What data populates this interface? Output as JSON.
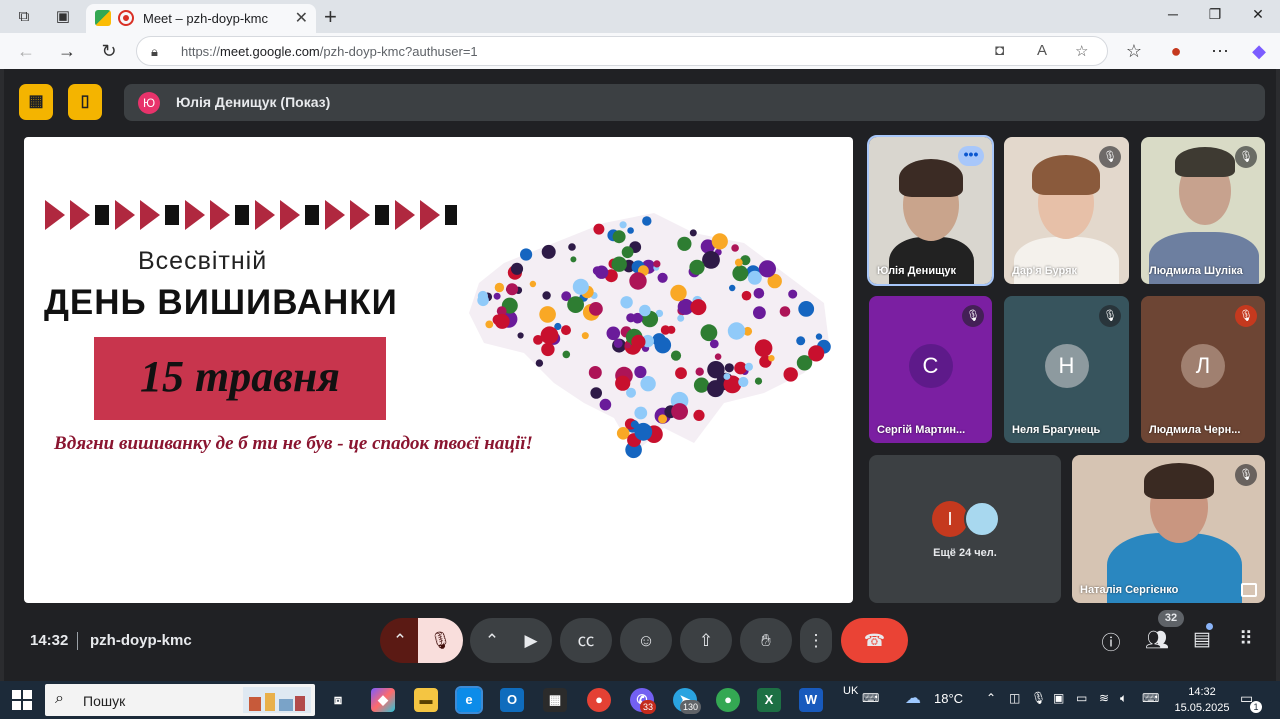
{
  "browser": {
    "tab_title": "Meet – pzh-doyp-kmc",
    "url_prefix": "https://",
    "url_host": "meet.google.com",
    "url_path": "/pzh-doyp-kmc?authuser=1"
  },
  "meet": {
    "presenter_initial": "Ю",
    "presenter_label": "Юлія Денищук (Показ)",
    "slide": {
      "title_line1": "Всесвітній",
      "title_line2": "ДЕНЬ ВИШИВАНКИ",
      "date": "15 травня",
      "slogan": "Вдягни вишиванку де б ти не був - це спадок твоєї нації!"
    },
    "participants": [
      {
        "name": "Юлія Денищук",
        "type": "video",
        "speaking": true
      },
      {
        "name": "Дар'я Буряк",
        "type": "video",
        "muted": true
      },
      {
        "name": "Людмила Шуліка",
        "type": "video",
        "muted": true
      },
      {
        "name": "Сергій Мартин...",
        "initial": "С",
        "type": "avatar",
        "bg": "#7b1fa2",
        "avatar_bg": "#5e1a8a",
        "muted": true
      },
      {
        "name": "Неля Брагунець",
        "initial": "Н",
        "type": "avatar",
        "bg": "#37545d",
        "avatar_bg": "#8d9a9f",
        "muted": true
      },
      {
        "name": "Людмила Черн...",
        "initial": "Л",
        "type": "avatar",
        "bg": "#6d4534",
        "avatar_bg": "#a08070",
        "muted": true
      },
      {
        "name": "Наталія Сергієнко",
        "type": "video",
        "muted": true
      }
    ],
    "others": {
      "initial": "І",
      "label": "Ещё 24 чел."
    },
    "time": "14:32",
    "meeting_code": "pzh-doyp-kmc",
    "people_count": "32"
  },
  "taskbar": {
    "search_placeholder": "Пошук",
    "keyboard_lang": "UK",
    "weather": "18°C",
    "clock_time": "14:32",
    "clock_date": "15.05.2025",
    "viber_badge": "33",
    "telegram_badge": "130",
    "notification_count": "1"
  },
  "colors": {
    "meet_bg": "#202124",
    "end_call": "#ea4335",
    "accent_yellow": "#f4b400",
    "mic_muted_bg": "#f9dedc"
  }
}
